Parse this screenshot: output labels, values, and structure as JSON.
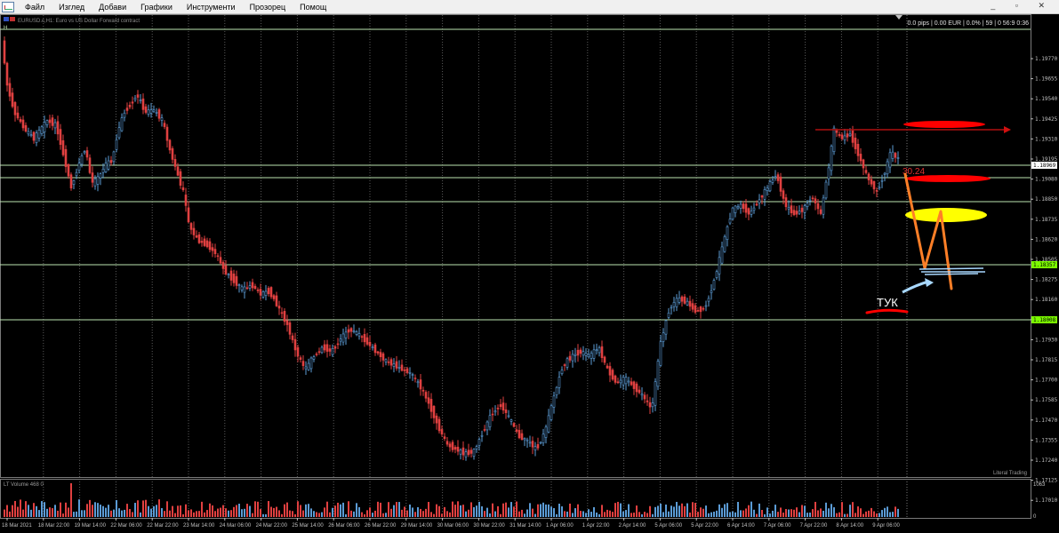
{
  "menu": {
    "items": [
      "Файл",
      "Изглед",
      "Добави",
      "Графики",
      "Инструменти",
      "Прозорец",
      "Помощ"
    ],
    "window_controls": "_ ▫ ✕"
  },
  "chart": {
    "header": "EURUSD.c,H1: Euro vs US Dollar Forward contract",
    "account_info": "0.0 pips | 0.00 EUR | 0.0% | 59 | 0 56:9 0:36",
    "watermark": "Literal Trading",
    "price_ticks": [
      "1.19770",
      "1.19655",
      "1.19540",
      "1.19425",
      "1.19310",
      "1.19195",
      "1.19080",
      "1.18850",
      "1.18735",
      "1.18620",
      "1.18505",
      "1.18275",
      "1.18160",
      "1.18045",
      "1.17930",
      "1.17815",
      "1.17700",
      "1.17585",
      "1.17470",
      "1.17355",
      "1.17240",
      "1.17125",
      "1.17010"
    ],
    "price_tags": [
      {
        "label": "1.18969",
        "color": "#ffffff"
      },
      {
        "label": "1.18357",
        "color": "#7cfc00"
      },
      {
        "label": "1.18008",
        "color": "#7cfc00"
      }
    ],
    "date_labels": [
      "18 Mar 2021",
      "18 Mar 22:00",
      "19 Mar 14:00",
      "22 Mar 06:00",
      "22 Mar 22:00",
      "23 Mar 14:00",
      "24 Mar 06:00",
      "24 Mar 22:00",
      "25 Mar 14:00",
      "26 Mar 06:00",
      "26 Mar 22:00",
      "29 Mar 14:00",
      "30 Mar 06:00",
      "30 Mar 22:00",
      "31 Mar 14:00",
      "1 Apr 06:00",
      "1 Apr 22:00",
      "2 Apr 14:00",
      "5 Apr 06:00",
      "5 Apr 22:00",
      "6 Apr 14:00",
      "7 Apr 06:00",
      "7 Apr 22:00",
      "8 Apr 14:00",
      "9 Apr 06:00"
    ],
    "volume_label": "LT Volume 468 0",
    "volume_ticks": [
      "1063",
      "0"
    ],
    "annotations": {
      "pips_text": "30.24",
      "tuk_text": "ТУК"
    },
    "colors": {
      "bull": "#5b9bd5",
      "bear": "#e04040",
      "grid": "#5a5a5a",
      "level_line": "#bde3b0",
      "orange": "#ff7f27",
      "yellow": "#ffff00",
      "red": "#ff0000",
      "light_blue": "#a8d8ff"
    }
  }
}
